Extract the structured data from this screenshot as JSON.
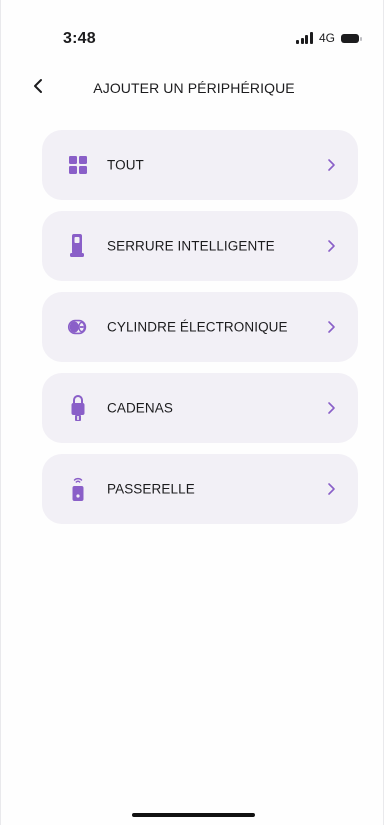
{
  "status_bar": {
    "time": "3:48",
    "network": "4G"
  },
  "header": {
    "title": "AJOUTER UN PÉRIPHÉRIQUE"
  },
  "items": [
    {
      "label": "TOUT",
      "icon": "grid-icon"
    },
    {
      "label": "SERRURE INTELLIGENTE",
      "icon": "smart-lock-icon"
    },
    {
      "label": "CYLINDRE ÉLECTRONIQUE",
      "icon": "cylinder-icon"
    },
    {
      "label": "CADENAS",
      "icon": "padlock-icon"
    },
    {
      "label": "PASSERELLE",
      "icon": "gateway-icon"
    }
  ],
  "colors": {
    "accent": "#8a5fc8",
    "card_bg": "#f2f0f6",
    "text": "#1c1c1e"
  }
}
